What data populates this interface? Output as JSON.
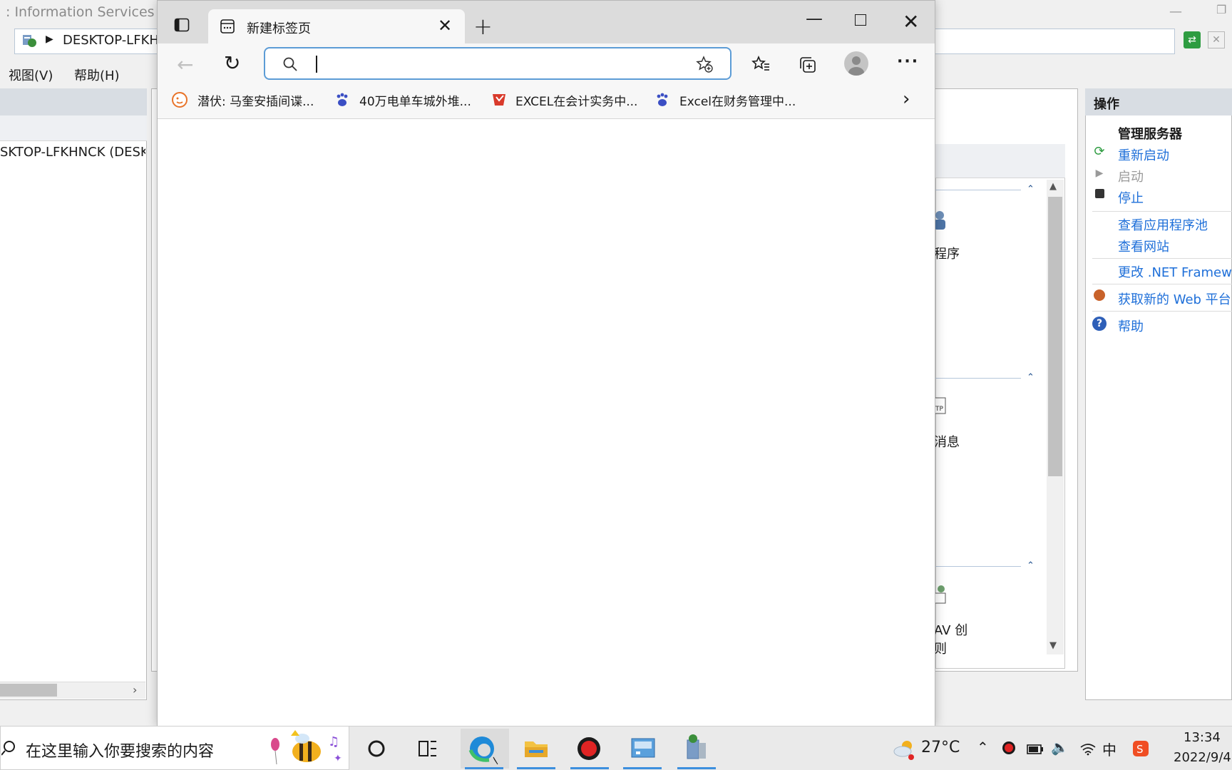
{
  "iis": {
    "title": ": Information Services (IIS)",
    "address": "DESKTOP-LFKH",
    "menu": [
      "视图(V)",
      "帮助(H)"
    ],
    "tree_node": "SKTOP-LFKHNCK (DESK",
    "center_groups": [
      {
        "label": "程序"
      },
      {
        "label": "消息"
      },
      {
        "label": "AV 创",
        "label2": "则"
      }
    ],
    "actions_title": "操作",
    "actions": {
      "heading": "管理服务器",
      "restart": "重新启动",
      "start": "启动",
      "stop": "停止",
      "view_app_pools": "查看应用程序池",
      "view_sites": "查看网站",
      "change_net": "更改 .NET Framewo",
      "get_web": "获取新的 Web 平台",
      "help": "帮助"
    }
  },
  "browser": {
    "tab_title": "新建标签页",
    "address_value": "",
    "favorites": [
      {
        "label": "潜伏: 马奎安插间谍..."
      },
      {
        "label": "40万电单车城外堆..."
      },
      {
        "label": "EXCEL在会计实务中..."
      },
      {
        "label": "Excel在财务管理中..."
      }
    ]
  },
  "taskbar": {
    "search_placeholder": "在这里输入你要搜索的内容",
    "temperature": "27°C",
    "ime": "中",
    "time": "13:34",
    "date": "2022/9/4"
  },
  "colors": {
    "accent": "#1e6fd9",
    "address_border": "#5c9cd6"
  }
}
